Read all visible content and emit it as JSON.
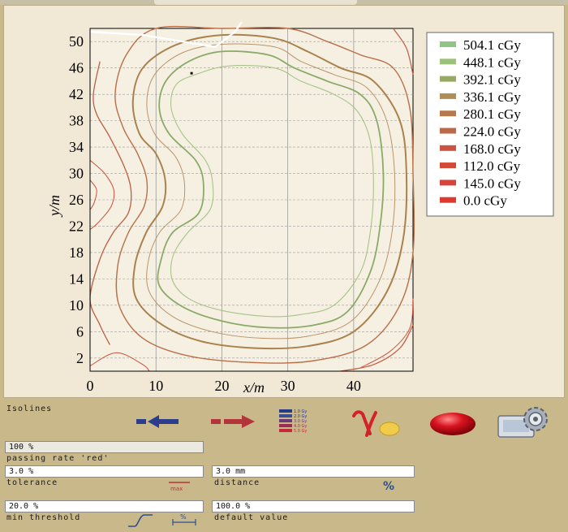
{
  "chart_data": {
    "type": "contour",
    "xlabel": "x/m",
    "ylabel": "y/m",
    "xlim": [
      0,
      49
    ],
    "ylim": [
      0,
      52
    ],
    "xticks": [
      0,
      10,
      20,
      30,
      40
    ],
    "yticks": [
      2,
      6,
      10,
      14,
      18,
      22,
      26,
      30,
      34,
      38,
      42,
      46,
      50
    ],
    "grid": true,
    "legend_position": "right",
    "series": [
      {
        "name": "504.1 cGy",
        "color": "#93c487"
      },
      {
        "name": "448.1 cGy",
        "color": "#9cc279"
      },
      {
        "name": "392.1 cGy",
        "color": "#98a963"
      },
      {
        "name": "336.1 cGy",
        "color": "#ae8f56"
      },
      {
        "name": "280.1 cGy",
        "color": "#b7794c"
      },
      {
        "name": "224.0 cGy",
        "color": "#bd6848"
      },
      {
        "name": "168.0 cGy",
        "color": "#c95440"
      },
      {
        "name": "112.0 cGy",
        "color": "#d44a38"
      },
      {
        "name": "145.0 cGy",
        "color": "#d8443a"
      },
      {
        "name": "0.0 cGy",
        "color": "#e03a30"
      }
    ],
    "contours": [
      {
        "level": "392.1 cGy",
        "color": "#8aab68",
        "width": 1.8,
        "points": [
          [
            15,
            47
          ],
          [
            20,
            48.5
          ],
          [
            27,
            48
          ],
          [
            31,
            46
          ],
          [
            36,
            44
          ],
          [
            41,
            42
          ],
          [
            43.5,
            38
          ],
          [
            44.5,
            30
          ],
          [
            44,
            22
          ],
          [
            42.5,
            15
          ],
          [
            39,
            9
          ],
          [
            34,
            7
          ],
          [
            27,
            6.6
          ],
          [
            20,
            7.6
          ],
          [
            14,
            9.8
          ],
          [
            10.5,
            13
          ],
          [
            10.8,
            17
          ],
          [
            12.5,
            21
          ],
          [
            16.5,
            24
          ],
          [
            17.2,
            28.5
          ],
          [
            16,
            32
          ],
          [
            12,
            36
          ],
          [
            10.5,
            40
          ],
          [
            11.5,
            44
          ]
        ]
      },
      {
        "level": "448.1 cGy",
        "color": "#a6c389",
        "width": 1.1,
        "points": [
          [
            16,
            45
          ],
          [
            21,
            46.3
          ],
          [
            28,
            46
          ],
          [
            32,
            44
          ],
          [
            37,
            42
          ],
          [
            40.5,
            39.5
          ],
          [
            42.5,
            35
          ],
          [
            43,
            28
          ],
          [
            42.5,
            21
          ],
          [
            41,
            15
          ],
          [
            37,
            10
          ],
          [
            32,
            8.6
          ],
          [
            27,
            8.3
          ],
          [
            20,
            9.2
          ],
          [
            15,
            11
          ],
          [
            12.5,
            13.8
          ],
          [
            12.6,
            17.5
          ],
          [
            14.8,
            21
          ],
          [
            18.2,
            24.5
          ],
          [
            18.6,
            28.5
          ],
          [
            17.5,
            32
          ],
          [
            14,
            36
          ],
          [
            12.3,
            40
          ],
          [
            13,
            43.4
          ]
        ]
      },
      {
        "level": "336.1 cGy",
        "color": "#a9824e",
        "width": 2.0,
        "points": [
          [
            13,
            49.5
          ],
          [
            20,
            51
          ],
          [
            28,
            50.5
          ],
          [
            33,
            48.5
          ],
          [
            38,
            46
          ],
          [
            43,
            44
          ],
          [
            47,
            38
          ],
          [
            48,
            30
          ],
          [
            47.5,
            20
          ],
          [
            45,
            12
          ],
          [
            40,
            6
          ],
          [
            33,
            3.8
          ],
          [
            25,
            3.5
          ],
          [
            17,
            4.5
          ],
          [
            11,
            7
          ],
          [
            7,
            11
          ],
          [
            6.8,
            16
          ],
          [
            8.5,
            21
          ],
          [
            11,
            25
          ],
          [
            11.4,
            29
          ],
          [
            10,
            33
          ],
          [
            7.5,
            36
          ],
          [
            6.5,
            41
          ],
          [
            8,
            46
          ]
        ]
      },
      {
        "level": "280.1 cGy",
        "color": "#b96f48",
        "width": 1.4,
        "points": [
          [
            10,
            52
          ],
          [
            20,
            53
          ],
          [
            30,
            52.5
          ],
          [
            36,
            50
          ],
          [
            41,
            48
          ],
          [
            46,
            46
          ],
          [
            48.5,
            40
          ],
          [
            49.5,
            30
          ],
          [
            49,
            18
          ],
          [
            47,
            10
          ],
          [
            42,
            4
          ],
          [
            34,
            1.6
          ],
          [
            25,
            1.3
          ],
          [
            15,
            2.3
          ],
          [
            8,
            5
          ],
          [
            4.4,
            10
          ],
          [
            4.2,
            16
          ],
          [
            5.8,
            21
          ],
          [
            8.2,
            25
          ],
          [
            8.6,
            29
          ],
          [
            7.2,
            33
          ],
          [
            5,
            37
          ],
          [
            3.8,
            42
          ],
          [
            5.5,
            48
          ]
        ]
      },
      {
        "level": "336.1 cGy",
        "color": "#b9936a",
        "width": 1.0,
        "points": [
          [
            14,
            48.3
          ],
          [
            20,
            49.6
          ],
          [
            28,
            49.2
          ],
          [
            32,
            47
          ],
          [
            37,
            45
          ],
          [
            42,
            43
          ],
          [
            45,
            38
          ],
          [
            46.2,
            30
          ],
          [
            45.8,
            21
          ],
          [
            43.8,
            13.5
          ],
          [
            39.5,
            7.5
          ],
          [
            33,
            5.3
          ],
          [
            26,
            5
          ],
          [
            18.5,
            6
          ],
          [
            12.5,
            8.3
          ],
          [
            9,
            12
          ],
          [
            8.8,
            16.5
          ],
          [
            10.5,
            21
          ],
          [
            13.8,
            24.5
          ],
          [
            14.3,
            28.7
          ],
          [
            13,
            32.5
          ],
          [
            9.8,
            36
          ],
          [
            8.6,
            40.5
          ],
          [
            9.8,
            45
          ]
        ]
      },
      {
        "level": "224.0 cGy",
        "color": "#bd5e43",
        "width": 1.3,
        "points": [
          [
            1.5,
            47
          ],
          [
            0.5,
            42
          ],
          [
            1,
            39
          ],
          [
            3,
            35.5
          ],
          [
            5.2,
            31
          ],
          [
            6.2,
            27.5
          ],
          [
            5.8,
            24
          ],
          [
            3.5,
            21
          ],
          [
            1.5,
            17
          ],
          [
            0,
            11
          ],
          [
            1.5,
            7
          ],
          [
            3,
            4
          ]
        ]
      },
      {
        "level": "168.0 cGy",
        "color": "#c9513d",
        "width": 1.0,
        "points": [
          [
            0,
            32
          ],
          [
            2.2,
            30
          ],
          [
            3.6,
            27.5
          ],
          [
            3.2,
            25
          ],
          [
            1.2,
            22.5
          ],
          [
            0,
            21.5
          ]
        ]
      },
      {
        "level": "112.0 cGy",
        "color": "#c9513d",
        "width": 1.0,
        "points": [
          [
            0,
            29
          ],
          [
            1,
            27.5
          ],
          [
            0.6,
            25.5
          ],
          [
            0,
            24.5
          ]
        ]
      },
      {
        "level": "168.0 cGy",
        "color": "#c35a40",
        "width": 1.2,
        "points": [
          [
            46,
            52
          ],
          [
            48,
            49
          ],
          [
            49.5,
            45
          ]
        ]
      },
      {
        "level": "168.0 cGy",
        "color": "#c35a40",
        "width": 1.2,
        "points": [
          [
            49.5,
            7
          ],
          [
            47,
            3.5
          ],
          [
            43,
            1
          ],
          [
            38,
            0
          ]
        ]
      },
      {
        "level": "112.0 cGy",
        "color": "#cd5641",
        "width": 1.0,
        "points": [
          [
            49.5,
            11
          ],
          [
            48.5,
            6.5
          ],
          [
            45.5,
            3
          ],
          [
            41,
            0.5
          ]
        ]
      },
      {
        "level": "224.0 cGy",
        "color": "#c9513d",
        "width": 1.0,
        "points": [
          [
            0,
            0.8
          ],
          [
            4,
            2.8
          ],
          [
            8,
            1
          ],
          [
            9,
            0
          ]
        ]
      }
    ],
    "white_overlay": [
      [
        0,
        51.5
      ],
      [
        8,
        51
      ],
      [
        14,
        50
      ],
      [
        19,
        49.2
      ],
      [
        22,
        51.5
      ],
      [
        23,
        53
      ]
    ],
    "marker": [
      15.4,
      45.2
    ]
  },
  "panel": {
    "isolines_label": "Isolines"
  },
  "fields": {
    "passing_rate": {
      "value": "100 %",
      "label": "passing rate 'red'"
    },
    "tolerance": {
      "value": "3.0 %",
      "label": "tolerance"
    },
    "distance": {
      "value": "3.0 mm",
      "label": "distance"
    },
    "min_threshold": {
      "value": "20.0 %",
      "label": "min threshold"
    },
    "default_value": {
      "value": "100.0 %",
      "label": "default value"
    }
  },
  "toolbar": {
    "mini_legend_lines": [
      "1.0 Gy",
      "2.0 Gy",
      "3.0 Gy",
      "4.0 Gy",
      "5.0 Gy"
    ],
    "percent_symbol": "%",
    "max_label": "max",
    "range_label": "%"
  },
  "colors": {
    "panel_background": "#c9b98a",
    "plot_background": "#f1e9d6",
    "arrow_blue": "#2d3d8e",
    "arrow_red": "#b3353a",
    "gamma_red": "#d2232a",
    "sphere_red": "#c4101b"
  }
}
